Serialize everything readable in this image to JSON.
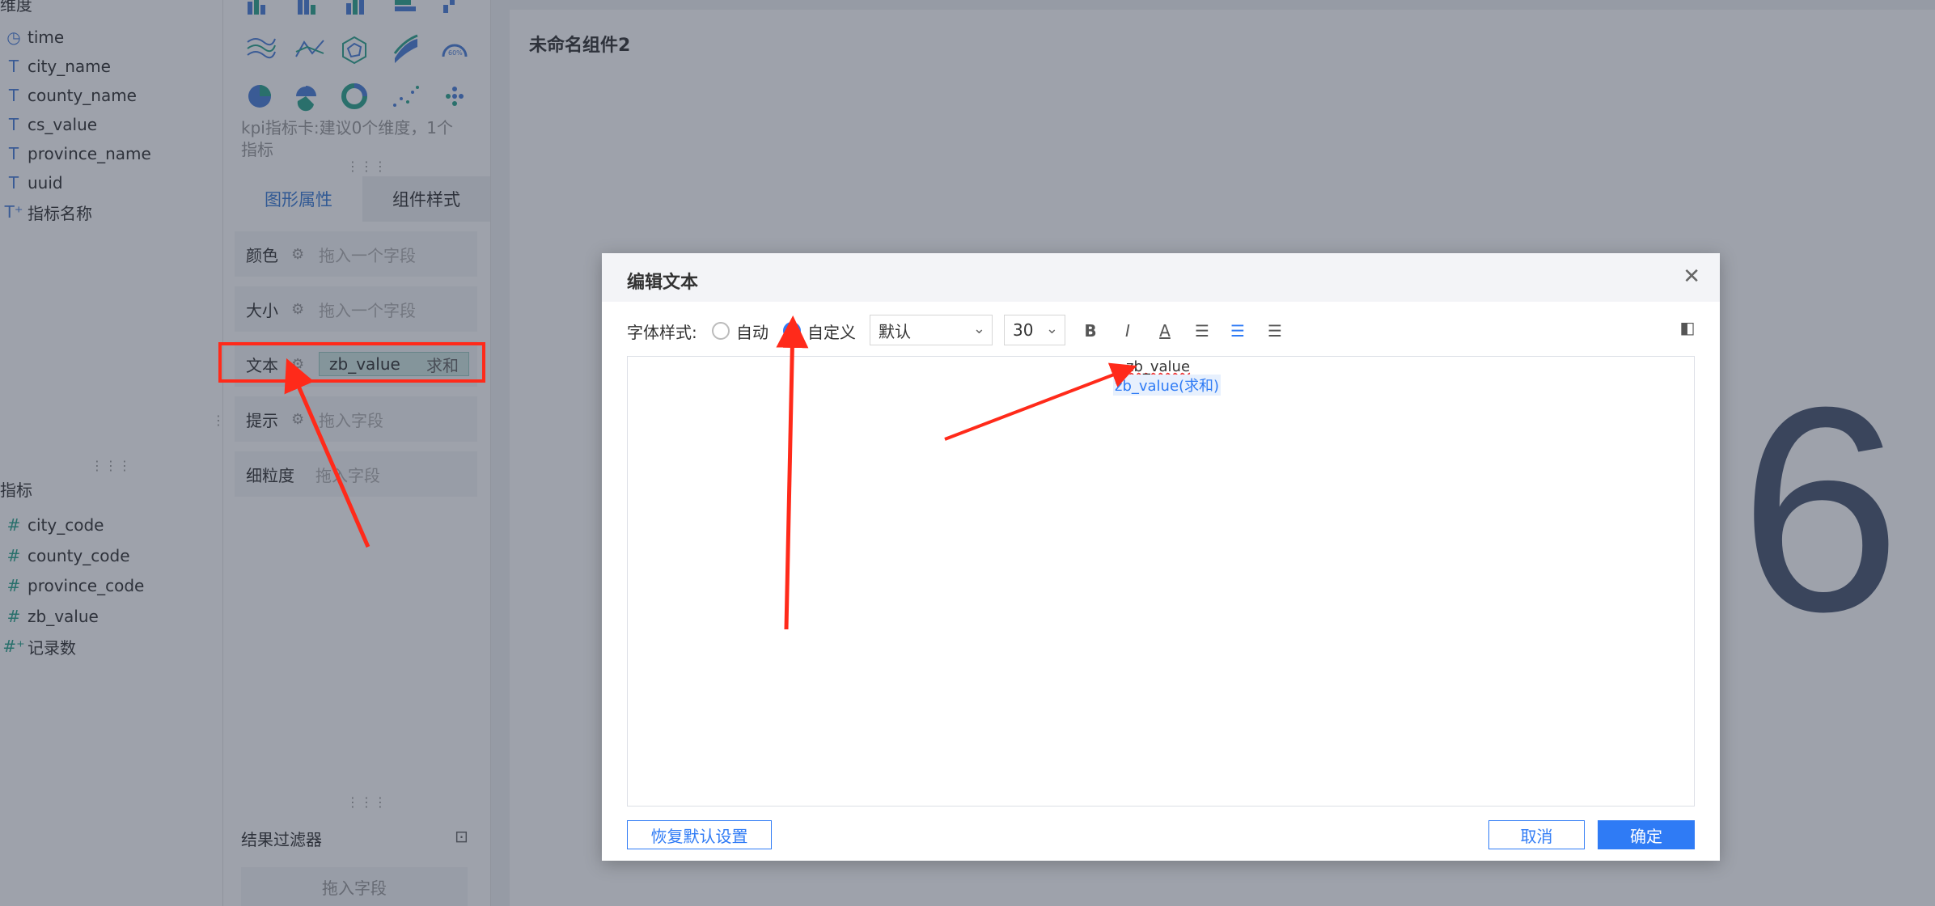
{
  "dimensions": {
    "title": "维度",
    "items": [
      {
        "icon": "clock-icon",
        "glyph": "◷",
        "name": "time"
      },
      {
        "icon": "text-field-icon",
        "glyph": "T",
        "name": "city_name"
      },
      {
        "icon": "text-field-icon",
        "glyph": "T",
        "name": "county_name"
      },
      {
        "icon": "text-field-icon",
        "glyph": "T",
        "name": "cs_value"
      },
      {
        "icon": "text-field-icon",
        "glyph": "T",
        "name": "province_name"
      },
      {
        "icon": "text-field-icon",
        "glyph": "T",
        "name": "uuid"
      },
      {
        "icon": "calc-text-field-icon",
        "glyph": "T⁺",
        "name": "指标名称"
      }
    ]
  },
  "measures": {
    "title": "指标",
    "items": [
      {
        "icon": "number-field-icon",
        "glyph": "#",
        "name": "city_code"
      },
      {
        "icon": "number-field-icon",
        "glyph": "#",
        "name": "county_code"
      },
      {
        "icon": "number-field-icon",
        "glyph": "#",
        "name": "province_code"
      },
      {
        "icon": "number-field-icon",
        "glyph": "#",
        "name": "zb_value"
      },
      {
        "icon": "calc-number-field-icon",
        "glyph": "#⁺",
        "name": "记录数"
      }
    ]
  },
  "config": {
    "hint": "kpi指标卡:建议0个维度，1个指标",
    "tabs": [
      "图形属性",
      "组件样式"
    ],
    "props": [
      {
        "label": "颜色",
        "placeholder": "拖入一个字段"
      },
      {
        "label": "大小",
        "placeholder": "拖入一个字段"
      },
      {
        "label": "文本",
        "field": "zb_value",
        "agg": "求和"
      },
      {
        "label": "提示",
        "placeholder": "拖入字段"
      },
      {
        "label": "细粒度",
        "placeholder": "拖入字段"
      }
    ],
    "filter_title": "结果过滤器",
    "filter_placeholder": "拖入字段"
  },
  "canvas": {
    "component_title": "未命名组件2",
    "big_value": "6"
  },
  "dialog": {
    "title": "编辑文本",
    "font_style_label": "字体样式:",
    "radio_auto": "自动",
    "radio_custom": "自定义",
    "font_family": "默认",
    "font_size": "30",
    "editor_line1": "zb_value",
    "editor_token": "zb_value(求和)",
    "btn_reset": "恢复默认设置",
    "btn_cancel": "取消",
    "btn_ok": "确定"
  },
  "colors": {
    "accent": "#2f7bf5",
    "annotation": "#ff2a1a",
    "highlight_pill": "#cfe7e2"
  }
}
